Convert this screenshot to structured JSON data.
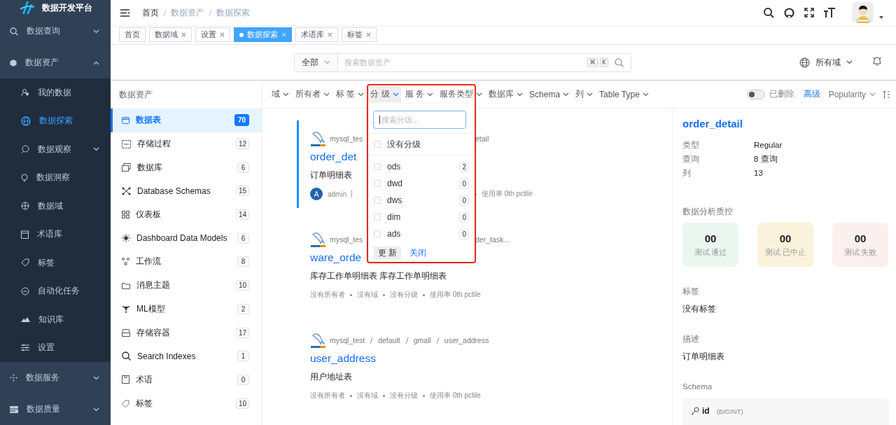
{
  "app": {
    "title": "数据开发平台"
  },
  "nav_menu": [
    {
      "label": "数据查询",
      "expanded": false
    },
    {
      "label": "数据资产",
      "expanded": true,
      "children": [
        {
          "label": "我的数据",
          "selected": false
        },
        {
          "label": "数据探索",
          "selected": true
        },
        {
          "label": "数据观察",
          "selected": false,
          "expanded": false
        },
        {
          "label": "数据洞察",
          "selected": false
        },
        {
          "label": "数据域",
          "selected": false
        },
        {
          "label": "术语库",
          "selected": false
        },
        {
          "label": "标签",
          "selected": false
        },
        {
          "label": "自动化任务",
          "selected": false
        },
        {
          "label": "知识库",
          "selected": false
        },
        {
          "label": "设置",
          "selected": false
        }
      ]
    },
    {
      "label": "数据服务",
      "expanded": false
    },
    {
      "label": "数据质量",
      "expanded": false
    }
  ],
  "breadcrumb": [
    "首页",
    "数据资产",
    "数据探索"
  ],
  "tabs": [
    {
      "label": "首页",
      "selected": false,
      "closable": false
    },
    {
      "label": "数据域",
      "selected": false,
      "closable": true
    },
    {
      "label": "设置",
      "selected": false,
      "closable": true
    },
    {
      "label": "数据探索",
      "selected": true,
      "closable": true
    },
    {
      "label": "术语库",
      "selected": false,
      "closable": true
    },
    {
      "label": "标签",
      "selected": false,
      "closable": true
    }
  ],
  "search": {
    "scope": "全部",
    "placeholder": "搜索数据资产",
    "shortcut": [
      "⌘",
      "K"
    ]
  },
  "domain_select": "所有域",
  "asset_panel": {
    "title": "数据资产",
    "items": [
      {
        "label": "数据表",
        "count": "70",
        "selected": true
      },
      {
        "label": "存储过程",
        "count": "12",
        "selected": false
      },
      {
        "label": "数据库",
        "count": "6",
        "selected": false
      },
      {
        "label": "Database Schemas",
        "count": "15",
        "selected": false
      },
      {
        "label": "仪表板",
        "count": "14",
        "selected": false
      },
      {
        "label": "Dashboard Data Models",
        "count": "6",
        "selected": false
      },
      {
        "label": "工作流",
        "count": "8",
        "selected": false
      },
      {
        "label": "消息主题",
        "count": "10",
        "selected": false
      },
      {
        "label": "ML模型",
        "count": "2",
        "selected": false
      },
      {
        "label": "存储容器",
        "count": "17",
        "selected": false
      },
      {
        "label": "Search Indexes",
        "count": "1",
        "selected": false
      },
      {
        "label": "术语",
        "count": "0",
        "selected": false
      },
      {
        "label": "标签",
        "count": "10",
        "selected": false
      }
    ]
  },
  "filters": [
    {
      "label": "域",
      "selected": false
    },
    {
      "label": "所有者",
      "selected": false
    },
    {
      "label": "标 签",
      "selected": false
    },
    {
      "label": "分 级",
      "selected": true
    },
    {
      "label": "服 务",
      "selected": false
    },
    {
      "label": "服务类型",
      "selected": false
    },
    {
      "label": "数据库",
      "selected": false
    },
    {
      "label": "Schema",
      "selected": false
    },
    {
      "label": "列",
      "selected": false
    },
    {
      "label": "Table Type",
      "selected": false
    }
  ],
  "show_deleted": {
    "label": "已删除",
    "on": false
  },
  "advanced_link": "高级",
  "sort": "Popularity",
  "tier_dropdown": {
    "placeholder": "搜索分级...",
    "none_option": {
      "label": "没有分级",
      "checked": false
    },
    "options": [
      {
        "label": "ods",
        "count": "2",
        "checked": false
      },
      {
        "label": "dwd",
        "count": "0",
        "checked": false
      },
      {
        "label": "dws",
        "count": "0",
        "checked": false
      },
      {
        "label": "dim",
        "count": "0",
        "checked": false
      },
      {
        "label": "ads",
        "count": "0",
        "checked": false
      }
    ],
    "update_button": "更 新",
    "close_link": "关闭"
  },
  "results": [
    {
      "selected": true,
      "path": [
        "mysql_tes"
      ],
      "path_tail": "etail",
      "title": "order_det",
      "description": "订单明细表",
      "owner": {
        "initial": "A",
        "name": "admin"
      },
      "meta_tail": "使用率 0th pctile"
    },
    {
      "selected": false,
      "path": [
        "mysql_tes"
      ],
      "path_tail": "der_task...",
      "title": "ware_orde",
      "description": "库存工作单明细表 库存工作单明细表",
      "meta": [
        "没有所有者",
        "没有域",
        "没有分级",
        "使用率 0th pctile"
      ]
    },
    {
      "selected": false,
      "path": [
        "mysql_test",
        "default",
        "gmall",
        "user_address"
      ],
      "title": "user_address",
      "description": "用户地址表",
      "meta": [
        "没有所有者",
        "没有域",
        "没有分级",
        "使用率 0th pctile"
      ]
    }
  ],
  "details": {
    "title": "order_detail",
    "properties": [
      {
        "label": "类型",
        "value": "Regular"
      },
      {
        "label": "查询",
        "value": "8 查询"
      },
      {
        "label": "列",
        "value": "13"
      }
    ],
    "quality_title": "数据分析质控",
    "tests": [
      {
        "count": "00",
        "label": "测试 通过",
        "color": "#eaf7f0"
      },
      {
        "count": "00",
        "label": "测试 已中止",
        "color": "#fbf2dc"
      },
      {
        "count": "00",
        "label": "测试 失败",
        "color": "#fbf0ee"
      }
    ],
    "tags_title": "标签",
    "tags_value": "没有标签",
    "description_title": "描述",
    "description_value": "订单明细表",
    "schema_title": "Schema",
    "schema_columns": [
      {
        "name": "id",
        "type": "(BIGINT)"
      }
    ]
  }
}
